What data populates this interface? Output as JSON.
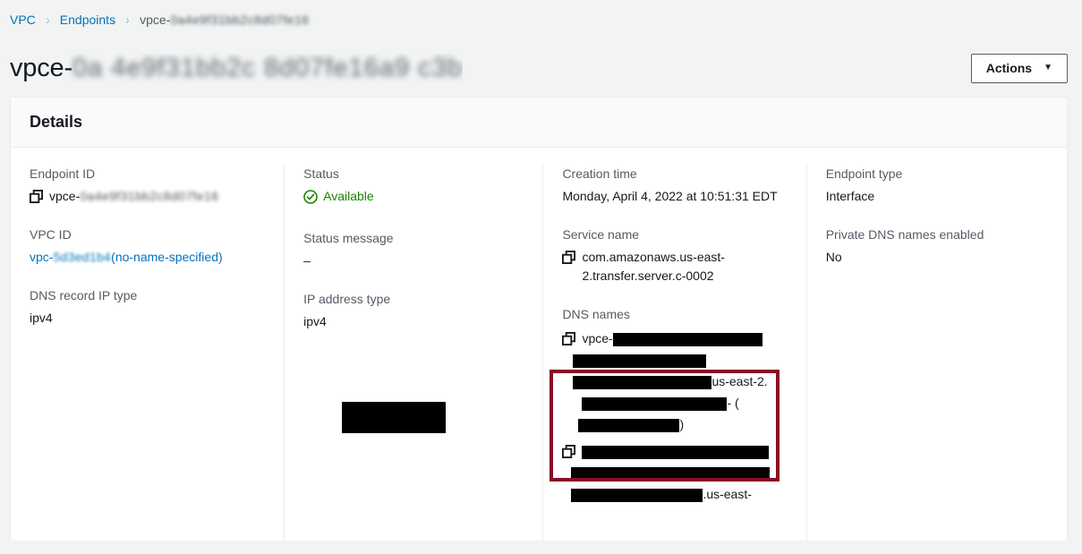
{
  "breadcrumb": {
    "items": [
      {
        "label": "VPC",
        "type": "link"
      },
      {
        "label": "Endpoints",
        "type": "link"
      },
      {
        "label": "vpce-",
        "type": "current",
        "redacted_suffix": true
      }
    ],
    "separator": "›"
  },
  "header": {
    "title_prefix": "vpce-",
    "title_redacted": true,
    "actions_button": {
      "label": "Actions",
      "caret": "▼"
    }
  },
  "details": {
    "section_title": "Details",
    "columns": [
      {
        "name": "column-1",
        "fields": [
          {
            "label": "Endpoint ID",
            "value_prefix": "vpce-",
            "value_blurred": true,
            "has_copy_icon": true,
            "icon": "copy-icon"
          },
          {
            "label": "VPC ID",
            "value_prefix": "vpc-",
            "value_blurred": true,
            "value_suffix": "(no-name-specified)",
            "is_link": true
          },
          {
            "label": "DNS record IP type",
            "value": "ipv4"
          }
        ]
      },
      {
        "name": "column-2",
        "fields": [
          {
            "label": "Status",
            "value": "Available",
            "status": "ok",
            "icon": "check-circle-icon"
          },
          {
            "label": "Status message",
            "value": "–"
          },
          {
            "label": "IP address type",
            "value": "ipv4"
          }
        ]
      },
      {
        "name": "column-3",
        "fields": [
          {
            "label": "Creation time",
            "value": "Monday, April 4, 2022 at 10:51:31 EDT"
          },
          {
            "label": "Service name",
            "value": "com.amazonaws.us-east-2.transfer.server.c-0002",
            "has_copy_icon": true,
            "icon": "copy-icon"
          },
          {
            "label": "DNS names",
            "is_dns_list": true
          }
        ]
      },
      {
        "name": "column-4",
        "fields": [
          {
            "label": "Endpoint type",
            "value": "Interface"
          },
          {
            "label": "Private DNS names enabled",
            "value": "No"
          }
        ]
      }
    ]
  },
  "dns_names": {
    "label": "DNS names",
    "entries": [
      {
        "highlighted": true,
        "icon": "copy-icon",
        "visible_fragments": [
          "vpce-",
          "us-east-",
          "2.",
          "- ("
        ]
      },
      {
        "highlighted": false,
        "icon": "copy-icon",
        "visible_fragments": [
          ".us-east-"
        ]
      }
    ]
  },
  "annotations": {
    "highlight_color": "#8c0b26",
    "redaction_color": "#000000",
    "status_ok_color": "#1d8102",
    "link_color": "#0073bb",
    "label_color": "#545b64"
  }
}
